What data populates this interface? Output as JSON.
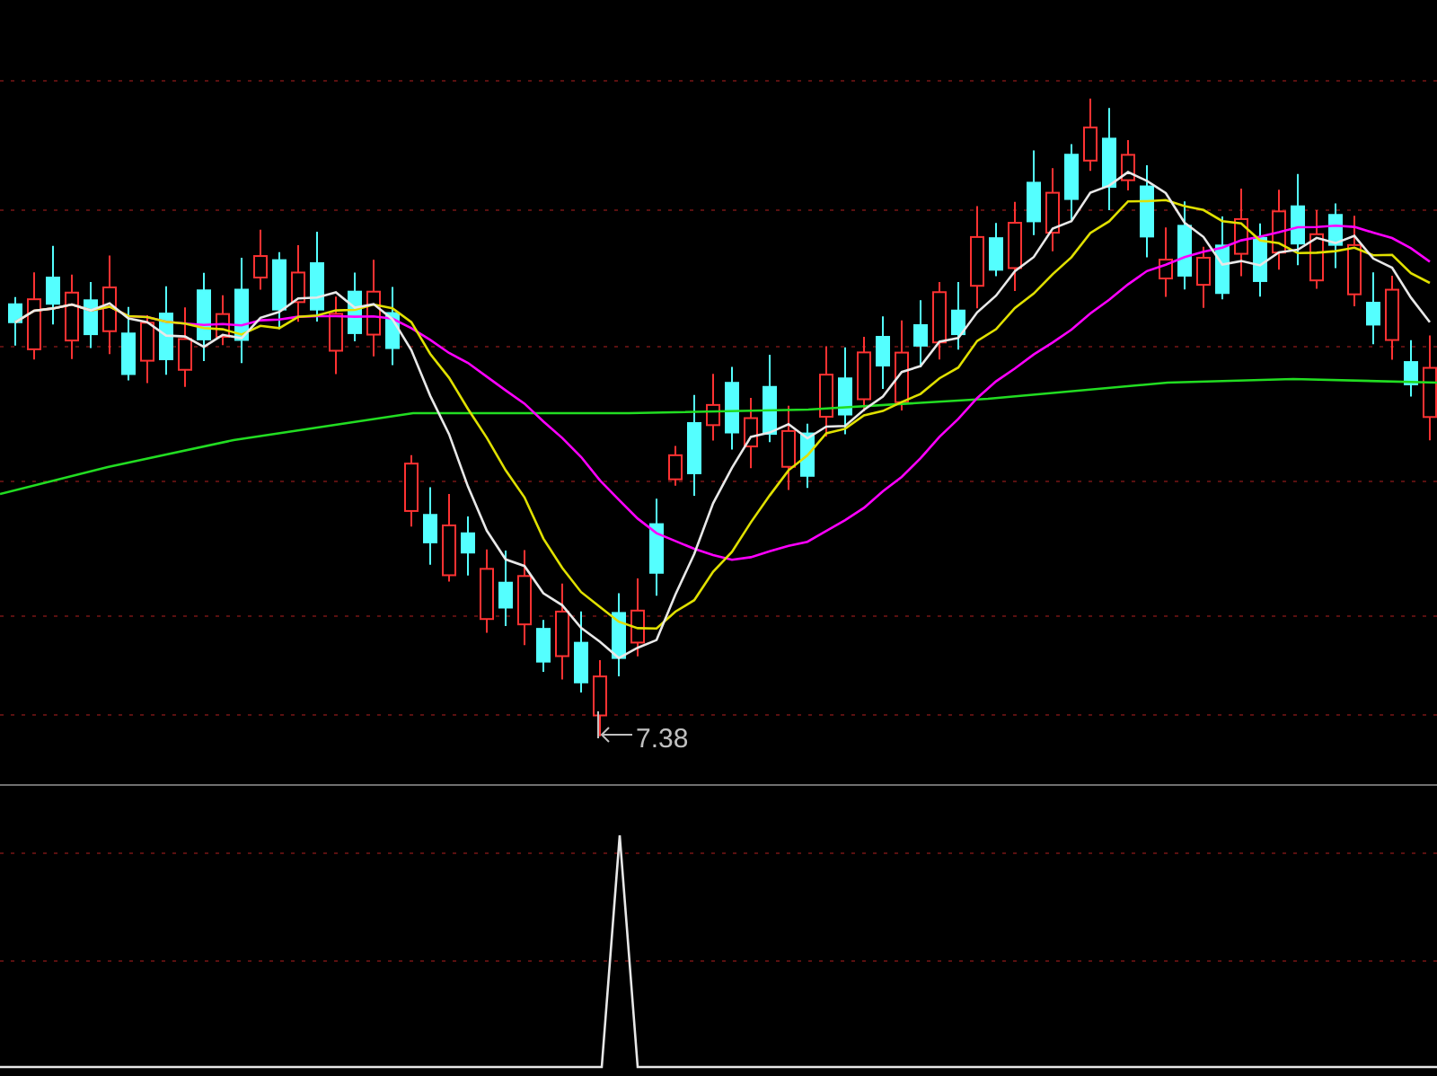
{
  "chart": {
    "low_marker": {
      "label": "7.38"
    }
  }
}
